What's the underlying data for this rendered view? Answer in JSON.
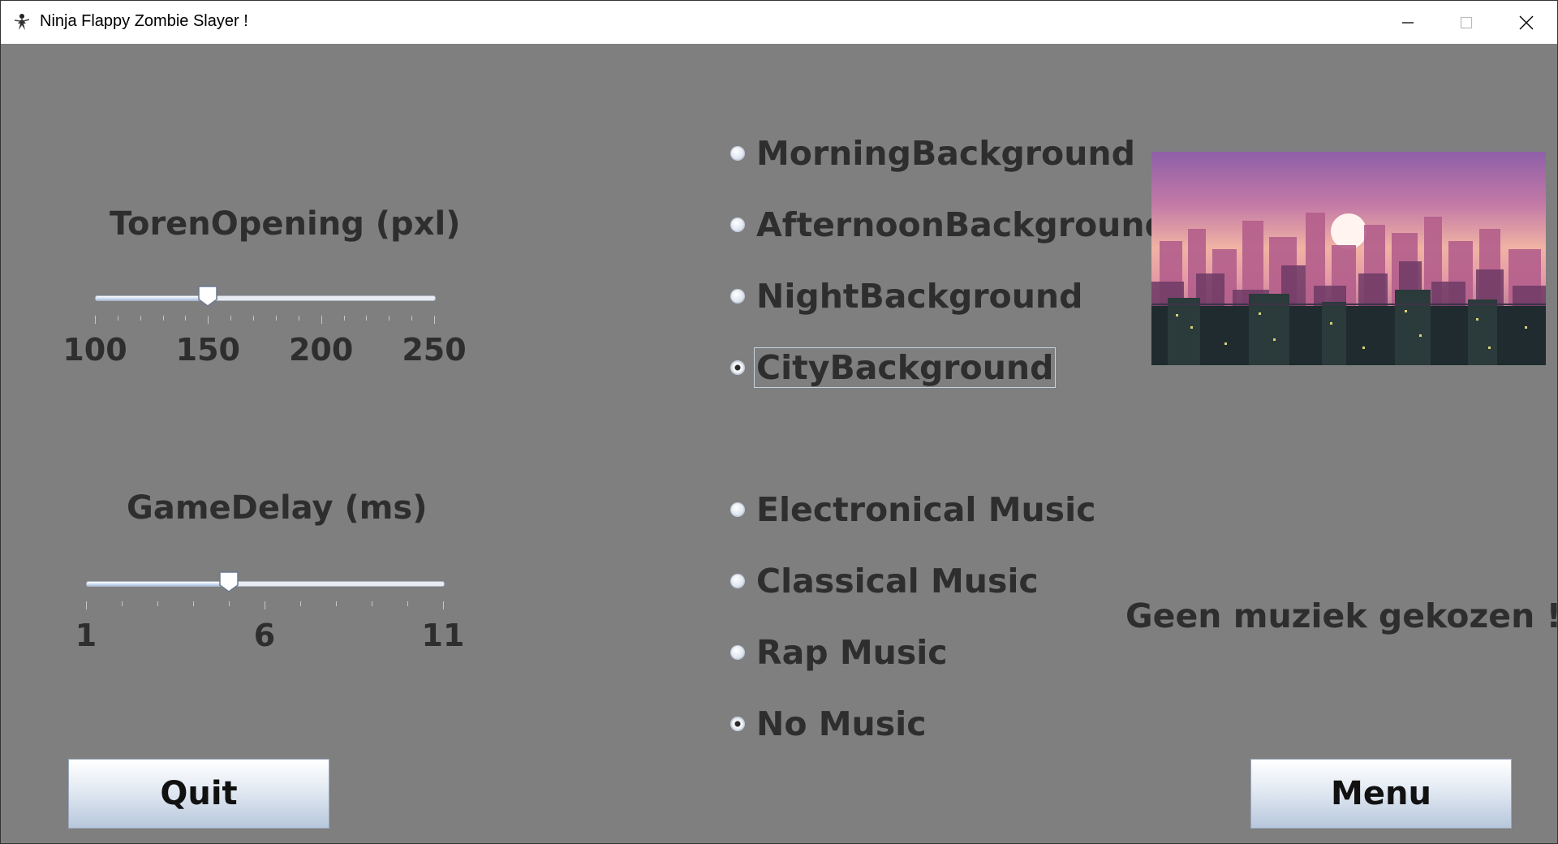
{
  "window": {
    "title": "Ninja Flappy Zombie Slayer !"
  },
  "sliders": {
    "toren": {
      "label": "TorenOpening (pxl)",
      "min": 100,
      "max": 250,
      "value": 150,
      "ticks": [
        "100",
        "150",
        "200",
        "250"
      ]
    },
    "delay": {
      "label": "GameDelay (ms)",
      "min": 1,
      "max": 11,
      "value": 5,
      "ticks": [
        "1",
        "6",
        "11"
      ]
    }
  },
  "backgrounds": {
    "options": [
      "MorningBackground",
      "AfternoonBackground",
      "NightBackground",
      "CityBackground"
    ],
    "selected": "CityBackground"
  },
  "music": {
    "options": [
      "Electronical Music",
      "Classical Music",
      "Rap Music",
      "No Music"
    ],
    "selected": "No Music",
    "status": "Geen muziek gekozen !"
  },
  "buttons": {
    "quit": "Quit",
    "menu": "Menu"
  },
  "colors": {
    "window_bg": "#7f7f7f",
    "text": "#2e2e2e",
    "title_bar": "#ffffff"
  }
}
